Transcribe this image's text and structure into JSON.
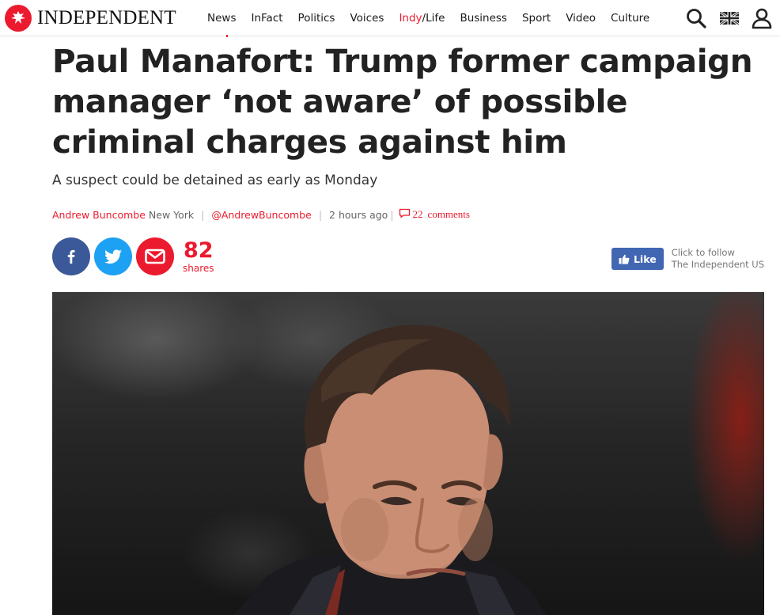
{
  "header": {
    "logo_text": "INDEPENDENT",
    "nav": [
      {
        "label": "News"
      },
      {
        "label": "InFact"
      },
      {
        "label": "Politics"
      },
      {
        "label": "Voices"
      },
      {
        "label_a": "Indy",
        "label_b": "/Life"
      },
      {
        "label": "Business"
      },
      {
        "label": "Sport"
      },
      {
        "label": "Video"
      },
      {
        "label": "Culture"
      }
    ],
    "icons": [
      "search-icon",
      "uk-flag-icon",
      "user-icon"
    ]
  },
  "article": {
    "headline": "Paul Manafort: Trump former campaign manager ‘not aware’ of possible criminal charges against him",
    "standfirst": "A suspect could be detained as early as Monday",
    "author": "Andrew Buncombe",
    "location": "New York",
    "twitter_handle": "@AndrewBuncombe",
    "timestamp": "2 hours ago",
    "comments_count": "22",
    "comments_label": "comments"
  },
  "share": {
    "count": "82",
    "count_label": "shares",
    "buttons": [
      "facebook-icon",
      "twitter-icon",
      "email-icon"
    ]
  },
  "follow": {
    "like_label": "Like",
    "line1": "Click to follow",
    "line2": "The Independent US"
  },
  "colors": {
    "brand_red": "#ec1a2e",
    "facebook": "#3b5998",
    "twitter": "#1da1f2",
    "fb_like": "#4267b2"
  }
}
